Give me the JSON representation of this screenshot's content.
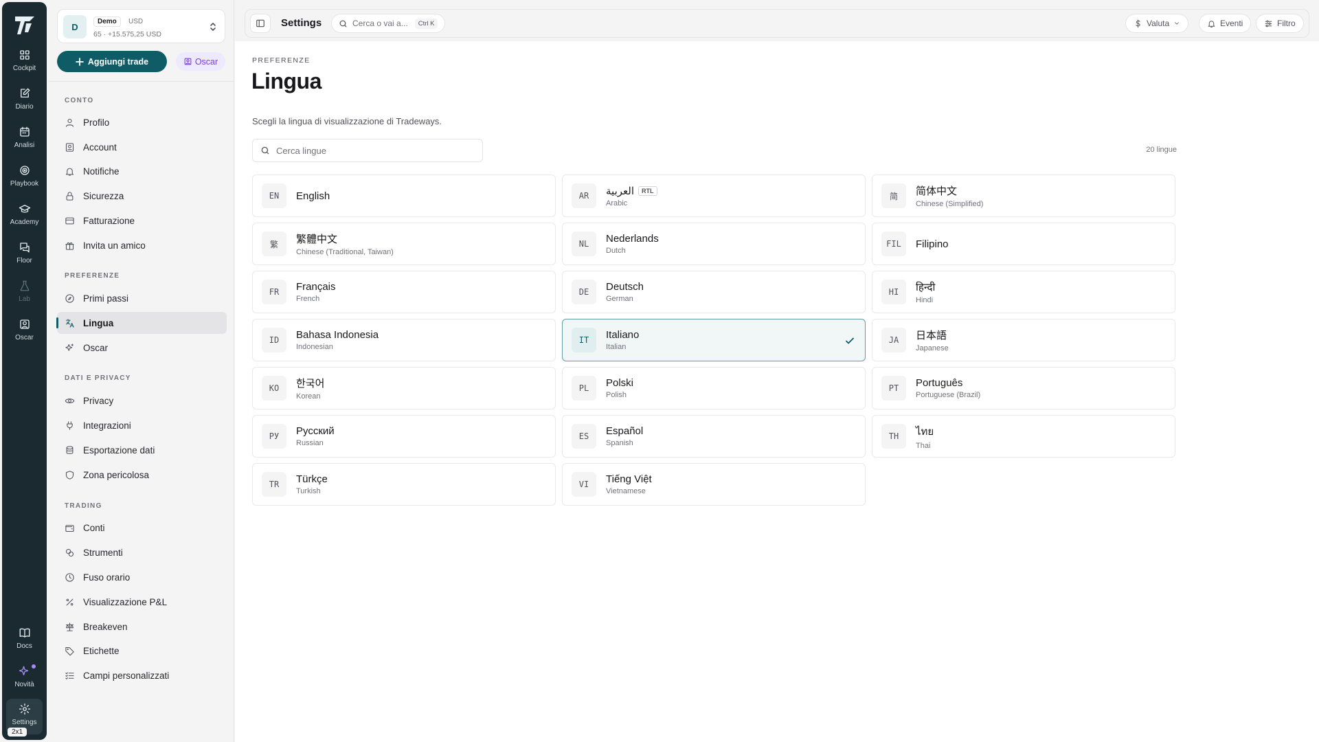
{
  "rail": {
    "items": [
      {
        "label": "Cockpit",
        "icon": "grid-icon"
      },
      {
        "label": "Diario",
        "icon": "edit-icon"
      },
      {
        "label": "Analisi",
        "icon": "calendar-icon"
      },
      {
        "label": "Playbook",
        "icon": "target-icon"
      },
      {
        "label": "Academy",
        "icon": "graduation-icon"
      },
      {
        "label": "Floor",
        "icon": "chat-icon"
      },
      {
        "label": "Lab",
        "icon": "flask-icon"
      },
      {
        "label": "Oscar",
        "icon": "user-square-icon"
      }
    ],
    "bottom": [
      {
        "label": "Docs",
        "icon": "book-icon"
      },
      {
        "label": "Novità",
        "icon": "sparkle-icon"
      },
      {
        "label": "Settings",
        "icon": "gear-icon"
      }
    ],
    "badge": "2x1"
  },
  "account": {
    "avatar": "D",
    "tag": "Demo",
    "currency": "USD",
    "sub": "65 · +15.575,25 USD"
  },
  "actions": {
    "add_trade": "Aggiungi trade",
    "oscar": "Oscar"
  },
  "sidebar": {
    "sections": [
      {
        "title": "CONTO",
        "items": [
          {
            "label": "Profilo"
          },
          {
            "label": "Account"
          },
          {
            "label": "Notifiche"
          },
          {
            "label": "Sicurezza"
          },
          {
            "label": "Fatturazione"
          },
          {
            "label": "Invita un amico"
          }
        ]
      },
      {
        "title": "PREFERENZE",
        "items": [
          {
            "label": "Primi passi"
          },
          {
            "label": "Lingua"
          },
          {
            "label": "Oscar"
          }
        ]
      },
      {
        "title": "DATI E PRIVACY",
        "items": [
          {
            "label": "Privacy"
          },
          {
            "label": "Integrazioni"
          },
          {
            "label": "Esportazione dati"
          },
          {
            "label": "Zona pericolosa"
          }
        ]
      },
      {
        "title": "TRADING",
        "items": [
          {
            "label": "Conti"
          },
          {
            "label": "Strumenti"
          },
          {
            "label": "Fuso orario"
          },
          {
            "label": "Visualizzazione P&L"
          },
          {
            "label": "Breakeven"
          },
          {
            "label": "Etichette"
          },
          {
            "label": "Campi personalizzati"
          }
        ]
      }
    ],
    "active": "Lingua"
  },
  "topbar": {
    "title": "Settings",
    "search_placeholder": "Cerca o vai a...",
    "shortcut": "Ctrl K",
    "currency_btn": "Valuta",
    "events_btn": "Eventi",
    "filter_btn": "Filtro"
  },
  "page": {
    "eyebrow": "PREFERENZE",
    "title": "Lingua",
    "description": "Scegli la lingua di visualizzazione di Tradeways.",
    "search_placeholder": "Cerca lingue",
    "count": "20 lingue"
  },
  "languages": [
    {
      "code": "EN",
      "native": "English",
      "english": ""
    },
    {
      "code": "AR",
      "native": "العربية",
      "english": "Arabic",
      "tag": "RTL"
    },
    {
      "code": "简",
      "native": "简体中文",
      "english": "Chinese (Simplified)"
    },
    {
      "code": "繁",
      "native": "繁體中文",
      "english": "Chinese (Traditional, Taiwan)"
    },
    {
      "code": "NL",
      "native": "Nederlands",
      "english": "Dutch"
    },
    {
      "code": "FIL",
      "native": "Filipino",
      "english": ""
    },
    {
      "code": "FR",
      "native": "Français",
      "english": "French"
    },
    {
      "code": "DE",
      "native": "Deutsch",
      "english": "German"
    },
    {
      "code": "HI",
      "native": "हिन्दी",
      "english": "Hindi"
    },
    {
      "code": "ID",
      "native": "Bahasa Indonesia",
      "english": "Indonesian"
    },
    {
      "code": "IT",
      "native": "Italiano",
      "english": "Italian",
      "selected": true
    },
    {
      "code": "JA",
      "native": "日本語",
      "english": "Japanese"
    },
    {
      "code": "KO",
      "native": "한국어",
      "english": "Korean"
    },
    {
      "code": "PL",
      "native": "Polski",
      "english": "Polish"
    },
    {
      "code": "PT",
      "native": "Português",
      "english": "Portuguese (Brazil)"
    },
    {
      "code": "РУ",
      "native": "Русский",
      "english": "Russian"
    },
    {
      "code": "ES",
      "native": "Español",
      "english": "Spanish"
    },
    {
      "code": "TH",
      "native": "ไทย",
      "english": "Thai"
    },
    {
      "code": "TR",
      "native": "Türkçe",
      "english": "Turkish"
    },
    {
      "code": "VI",
      "native": "Tiếng Việt",
      "english": "Vietnamese"
    }
  ],
  "colors": {
    "rail_bg": "#1b2a31",
    "accent": "#0f5b66",
    "oscar_accent": "#7c3aed",
    "selected_bg": "#f1f7f7"
  }
}
